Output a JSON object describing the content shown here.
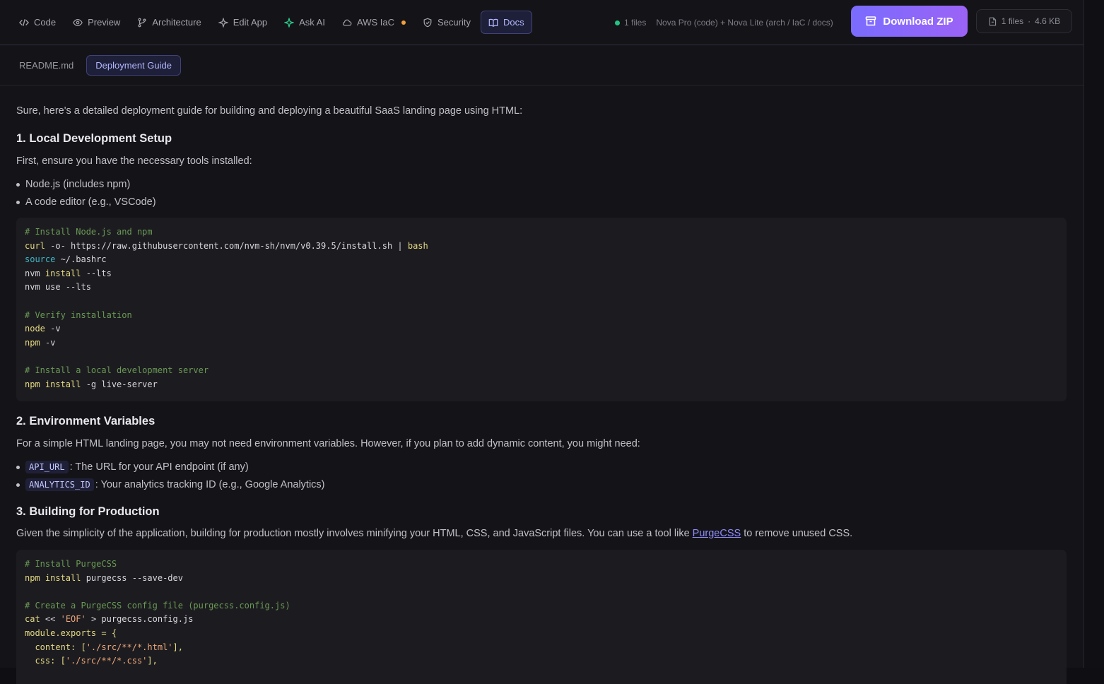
{
  "topbar": {
    "tabs": [
      {
        "label": "Code",
        "icon": "code-icon"
      },
      {
        "label": "Preview",
        "icon": "eye-icon"
      },
      {
        "label": "Architecture",
        "icon": "branch-icon"
      },
      {
        "label": "Edit App",
        "icon": "sparkle-icon"
      },
      {
        "label": "Ask AI",
        "icon": "sparkle-green-icon"
      },
      {
        "label": "AWS IaC",
        "icon": "cloud-icon"
      },
      {
        "label": "Security",
        "icon": "shield-icon"
      },
      {
        "label": "Docs",
        "icon": "book-icon"
      }
    ],
    "active_tab": "Docs",
    "status_files": "1 files",
    "status_models": "Nova Pro (code) + Nova Lite (arch / IaC / docs)",
    "download_label": "Download ZIP",
    "files_count": "1 files",
    "files_sep": "·",
    "files_size": "4.6 KB"
  },
  "subtabs": [
    "README.md",
    "Deployment Guide"
  ],
  "doc": {
    "intro": "Sure, here's a detailed deployment guide for building and deploying a beautiful SaaS landing page using HTML:",
    "s1_title": "1. Local Development Setup",
    "s1_p": "First, ensure you have the necessary tools installed:",
    "s1_b1": "Node.js (includes npm)",
    "s1_b2": "A code editor (e.g., VSCode)",
    "code1": {
      "l1": "# Install Node.js and npm",
      "l2a": "curl",
      "l2b": " -o- https://raw.githubusercontent.com/nvm-sh/nvm/v0.39.5/install.sh | ",
      "l2c": "bash",
      "l3a": "source",
      "l3b": " ~/.bashrc",
      "l4a": "nvm ",
      "l4b": "install",
      "l4c": " --lts",
      "l5": "nvm use --lts",
      "l6": "# Verify installation",
      "l7a": "node",
      "l7b": " -v",
      "l8a": "npm",
      "l8b": " -v",
      "l9": "# Install a local development server",
      "l10a": "npm ",
      "l10b": "install",
      "l10c": " -g live-server"
    },
    "s2_title": "2. Environment Variables",
    "s2_p": "For a simple HTML landing page, you may not need environment variables. However, if you plan to add dynamic content, you might need:",
    "s2_b1_code": "API_URL",
    "s2_b1_text": ": The URL for your API endpoint (if any)",
    "s2_b2_code": "ANALYTICS_ID",
    "s2_b2_text": ": Your analytics tracking ID (e.g., Google Analytics)",
    "s3_title": "3. Building for Production",
    "s3_p_a": "Given the simplicity of the application, building for production mostly involves minifying your HTML, CSS, and JavaScript files. You can use a tool like ",
    "s3_link": "PurgeCSS",
    "s3_p_b": " to remove unused CSS.",
    "code2": {
      "l1": "# Install PurgeCSS",
      "l2a": "npm ",
      "l2b": "install",
      "l2c": " purgecss --save-dev",
      "l3": "# Create a PurgeCSS config file (purgecss.config.js)",
      "l4a": "cat",
      "l4b": " << ",
      "l4c": "'EOF'",
      "l4d": " > purgecss.config.js",
      "l5": "module.exports = {",
      "l6a": "  content: [",
      "l6b": "'./src/**/*.html'",
      "l6c": "],",
      "l7a": "  css: [",
      "l7b": "'./src/**/*.css'",
      "l7c": "],"
    }
  }
}
